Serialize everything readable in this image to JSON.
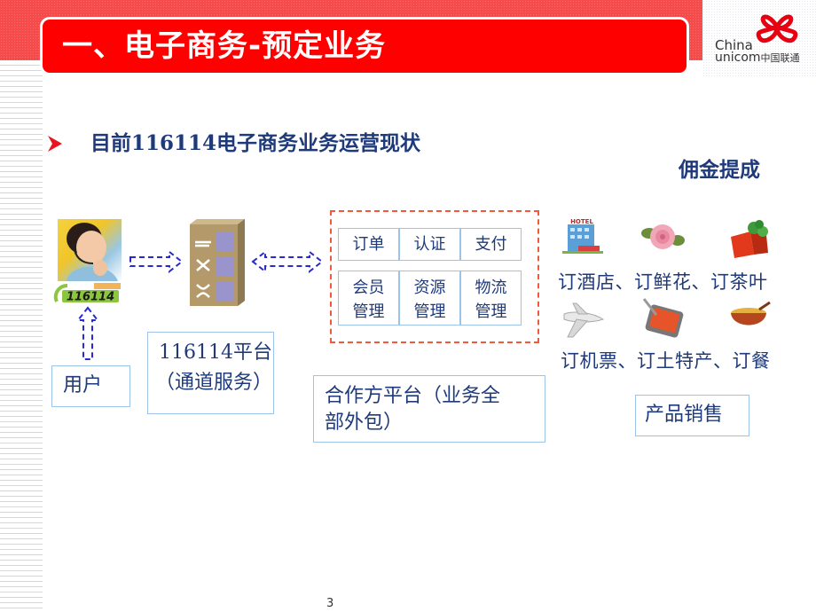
{
  "slide": {
    "title": "一、电子商务-预定业务",
    "subtitle": "目前116114电子商务业务运营现状",
    "commission_label": "佣金提成",
    "page_number": "3"
  },
  "logo": {
    "line1": "China",
    "line2": "unicom",
    "line2_cn": "中国联通"
  },
  "colors": {
    "title_bar": "#ff0000",
    "top_band": "#f54b4b",
    "text_blue": "#1f3a7a",
    "box_border": "#9cc3ea",
    "dashed_red": "#f05a3c",
    "arrow_blue": "#2a2acc"
  },
  "diagram": {
    "user_logo_text": "116114",
    "user_box": "用户",
    "platform_box": {
      "line1": "116114平台",
      "line2": "（通道服务）"
    },
    "partner_box": {
      "line1": "合作方平台（业务全",
      "line2": "部外包）"
    },
    "partner_modules": {
      "row1": [
        "订单",
        "认证",
        "支付"
      ],
      "row2": [
        {
          "line1": "会员",
          "line2": "管理"
        },
        {
          "line1": "资源",
          "line2": "管理"
        },
        {
          "line1": "物流",
          "line2": "管理"
        }
      ]
    },
    "products": {
      "row1_label": "订酒店、订鲜花、订茶叶",
      "row2_label": "订机票、订土特产、订餐",
      "icons_row1": [
        "hotel-icon",
        "flower-icon",
        "tea-icon"
      ],
      "icons_row2": [
        "airplane-icon",
        "specialty-product-icon",
        "meal-icon"
      ],
      "hotel_sign": "HOTEL"
    },
    "sales_box": "产品销售"
  }
}
